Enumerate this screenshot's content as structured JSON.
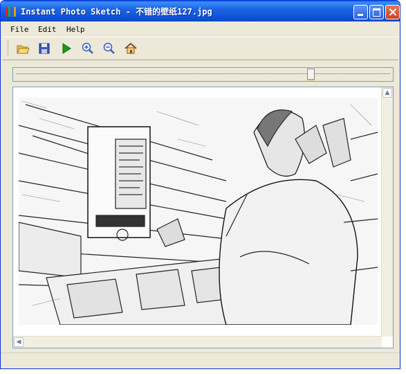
{
  "window": {
    "title": "Instant Photo Sketch - 不错的壁纸127.jpg",
    "icon": "pencils-icon"
  },
  "menu": {
    "items": [
      {
        "label": "File"
      },
      {
        "label": "Edit"
      },
      {
        "label": "Help"
      }
    ]
  },
  "toolbar": {
    "buttons": [
      {
        "icon": "open-folder-icon"
      },
      {
        "icon": "save-disk-icon"
      },
      {
        "icon": "play-icon"
      },
      {
        "icon": "zoom-in-icon"
      },
      {
        "icon": "zoom-out-icon"
      },
      {
        "icon": "home-icon"
      }
    ]
  },
  "zoom": {
    "level_fraction": 0.79
  },
  "colors": {
    "titlebar": "#0a50d4",
    "play": "#1a9a1a",
    "window_face": "#ece9d8"
  }
}
